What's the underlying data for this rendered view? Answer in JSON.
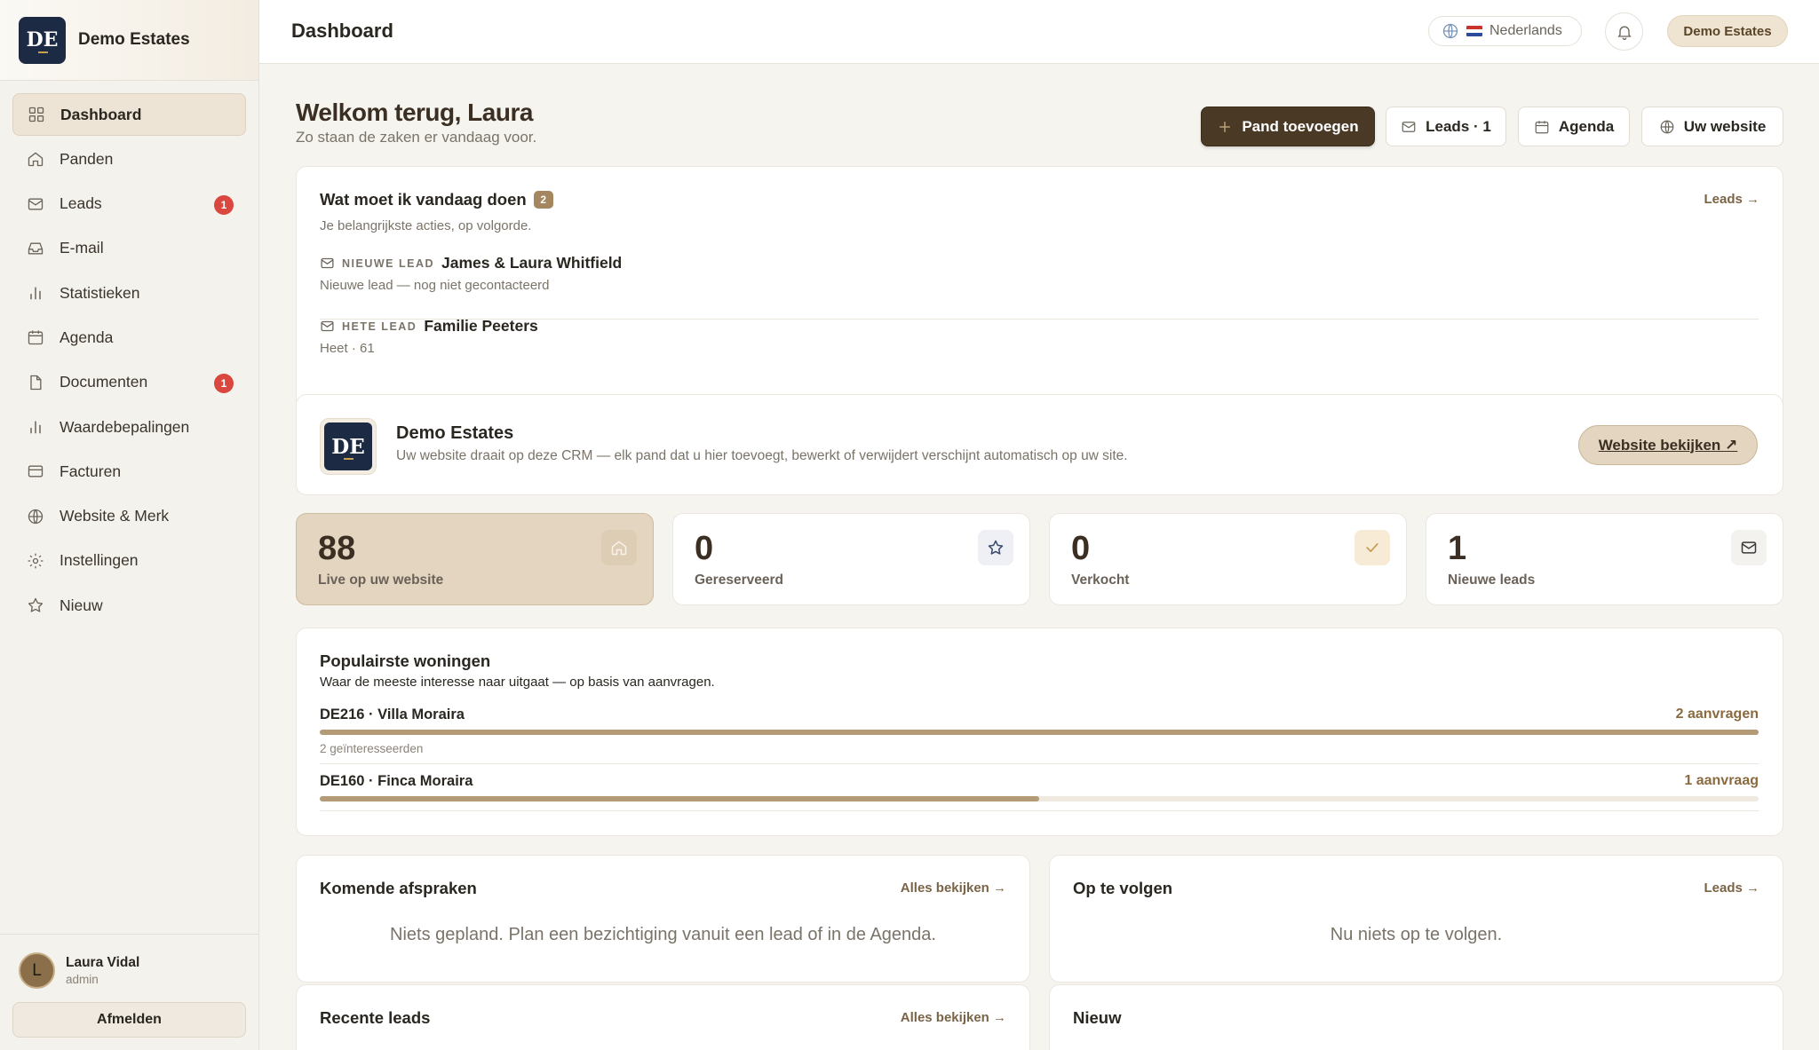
{
  "brand": {
    "initials": "DE",
    "name": "Demo Estates"
  },
  "sidebar": {
    "items": [
      {
        "label": "Dashboard",
        "icon": "grid-icon",
        "active": true
      },
      {
        "label": "Panden",
        "icon": "home-icon"
      },
      {
        "label": "Leads",
        "icon": "mail-icon",
        "badge": "1"
      },
      {
        "label": "E-mail",
        "icon": "inbox-icon"
      },
      {
        "label": "Statistieken",
        "icon": "bar-chart-icon"
      },
      {
        "label": "Agenda",
        "icon": "calendar-icon"
      },
      {
        "label": "Documenten",
        "icon": "file-icon",
        "badge": "1"
      },
      {
        "label": "Waardebepalingen",
        "icon": "bar-chart-icon"
      },
      {
        "label": "Facturen",
        "icon": "credit-card-icon"
      },
      {
        "label": "Website & Merk",
        "icon": "globe-icon"
      },
      {
        "label": "Instellingen",
        "icon": "gear-icon"
      },
      {
        "label": "Nieuw",
        "icon": "star-icon"
      }
    ]
  },
  "user": {
    "initial": "L",
    "name": "Laura Vidal",
    "role": "admin",
    "logout_label": "Afmelden"
  },
  "header": {
    "title": "Dashboard",
    "language": "Nederlands",
    "org": "Demo Estates"
  },
  "welcome": {
    "title": "Welkom terug, Laura",
    "subtitle": "Zo staan de zaken er vandaag voor."
  },
  "actions": {
    "add_property": "Pand toevoegen",
    "leads": "Leads · 1",
    "agenda": "Agenda",
    "website": "Uw website"
  },
  "todo": {
    "title": "Wat moet ik vandaag doen",
    "count": "2",
    "subtitle": "Je belangrijkste acties, op volgorde.",
    "link": "Leads →",
    "items": [
      {
        "tag": "NIEUWE LEAD",
        "name": "James & Laura Whitfield",
        "desc": "Nieuwe lead — nog niet gecontacteerd"
      },
      {
        "tag": "HETE LEAD",
        "name": "Familie Peeters",
        "desc": "Heet · 61"
      }
    ]
  },
  "site": {
    "initials": "DE",
    "name": "Demo Estates",
    "desc": "Uw website draait op deze CRM — elk pand dat u hier toevoegt, bewerkt of verwijdert verschijnt automatisch op uw site.",
    "button": "Website bekijken ↗"
  },
  "stats": [
    {
      "value": "88",
      "label": "Live op uw website",
      "icon": "home-icon"
    },
    {
      "value": "0",
      "label": "Gereserveerd",
      "icon": "star-icon"
    },
    {
      "value": "0",
      "label": "Verkocht",
      "icon": "check-icon"
    },
    {
      "value": "1",
      "label": "Nieuwe leads",
      "icon": "mail-icon"
    }
  ],
  "popular": {
    "title": "Populairste woningen",
    "subtitle": "Waar de meeste interesse naar uitgaat — op basis van aanvragen.",
    "items": [
      {
        "name": "DE216 · Villa Moraira",
        "count": "2 aanvragen",
        "sub": "2 geïnteresseerden",
        "fraction": 1.0
      },
      {
        "name": "DE160 · Finca Moraira",
        "count": "1 aanvraag",
        "sub": "",
        "fraction": 0.5
      }
    ]
  },
  "appointments": {
    "title": "Komende afspraken",
    "link": "Alles bekijken →",
    "empty": "Niets gepland. Plan een bezichtiging vanuit een lead of in de Agenda."
  },
  "followup": {
    "title": "Op te volgen",
    "link": "Leads →",
    "empty": "Nu niets op te volgen."
  },
  "recent_leads": {
    "title": "Recente leads",
    "link": "Alles bekijken →"
  },
  "news": {
    "title": "Nieuw"
  }
}
